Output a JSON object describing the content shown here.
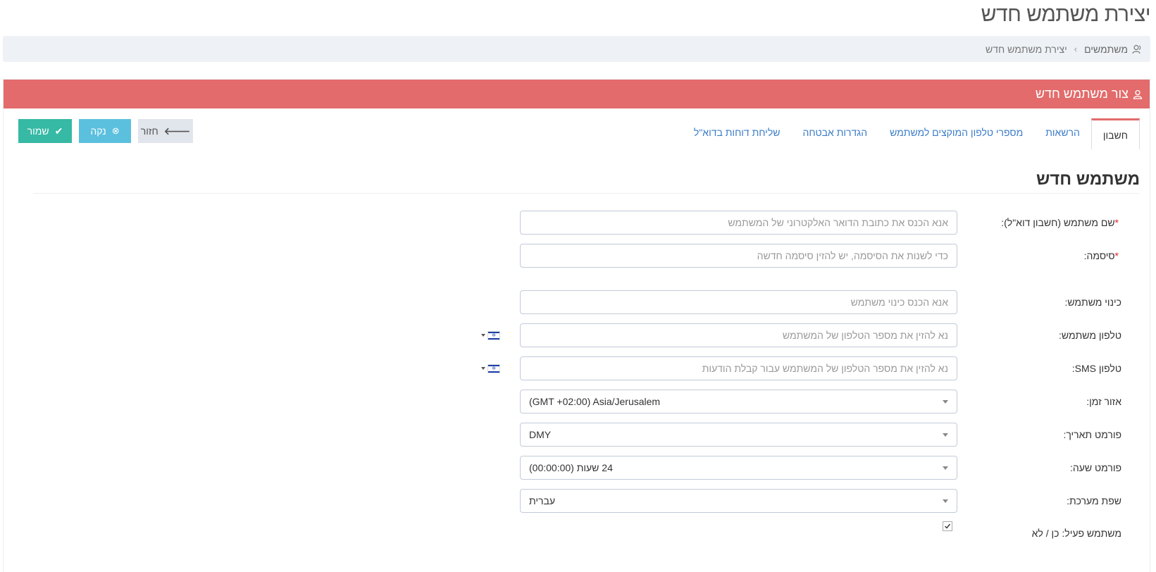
{
  "page_title": "יצירת משתמש חדש",
  "breadcrumb": {
    "parent": "משתמשים",
    "current": "יצירת משתמש חדש"
  },
  "portlet_title": "צור משתמש חדש",
  "tabs": [
    {
      "label": "חשבון",
      "active": true
    },
    {
      "label": "הרשאות"
    },
    {
      "label": "מספרי טלפון המוקצים למשתמש"
    },
    {
      "label": "הגדרות אבטחה"
    },
    {
      "label": "שליחת דוחות בדוא\"ל"
    }
  ],
  "actions": {
    "save": "שמור",
    "clear": "נקה",
    "back": "חזור"
  },
  "section_title": "משתמש חדש",
  "form": {
    "username_label": "שם משתמש (חשבון דוא\"ל):",
    "username_placeholder": "אנא הכנס את כתובת הדואר האלקטרוני של המשתמש",
    "password_label": "סיסמה:",
    "password_placeholder": "כדי לשנות את הסיסמה, יש להזין סיסמה חדשה",
    "nickname_label": "כינוי משתמש:",
    "nickname_placeholder": "אנא הכנס כינוי משתמש",
    "phone_label": "טלפון משתמש:",
    "phone_placeholder": "נא להזין את מספר הטלפון של המשתמש",
    "sms_label": "טלפון SMS:",
    "sms_placeholder": "נא להזין את מספר הטלפון של המשתמש עבור קבלת הודעות",
    "timezone_label": "אזור זמן:",
    "timezone_value": "(GMT +02:00) Asia/Jerusalem",
    "date_format_label": "פורמט תאריך:",
    "date_format_value": "DMY",
    "time_format_label": "פורמט שעה:",
    "time_format_value": "24 שעות (00:00:00)",
    "language_label": "שפת מערכת:",
    "language_value": "עברית",
    "active_label": "משתמש פעיל: כן / לא",
    "active_checked": true
  },
  "colors": {
    "portlet_header": "#e36b6b",
    "save_button": "#36b9a5",
    "clear_button": "#5bc0de",
    "tab_link": "#3a7cc8"
  }
}
